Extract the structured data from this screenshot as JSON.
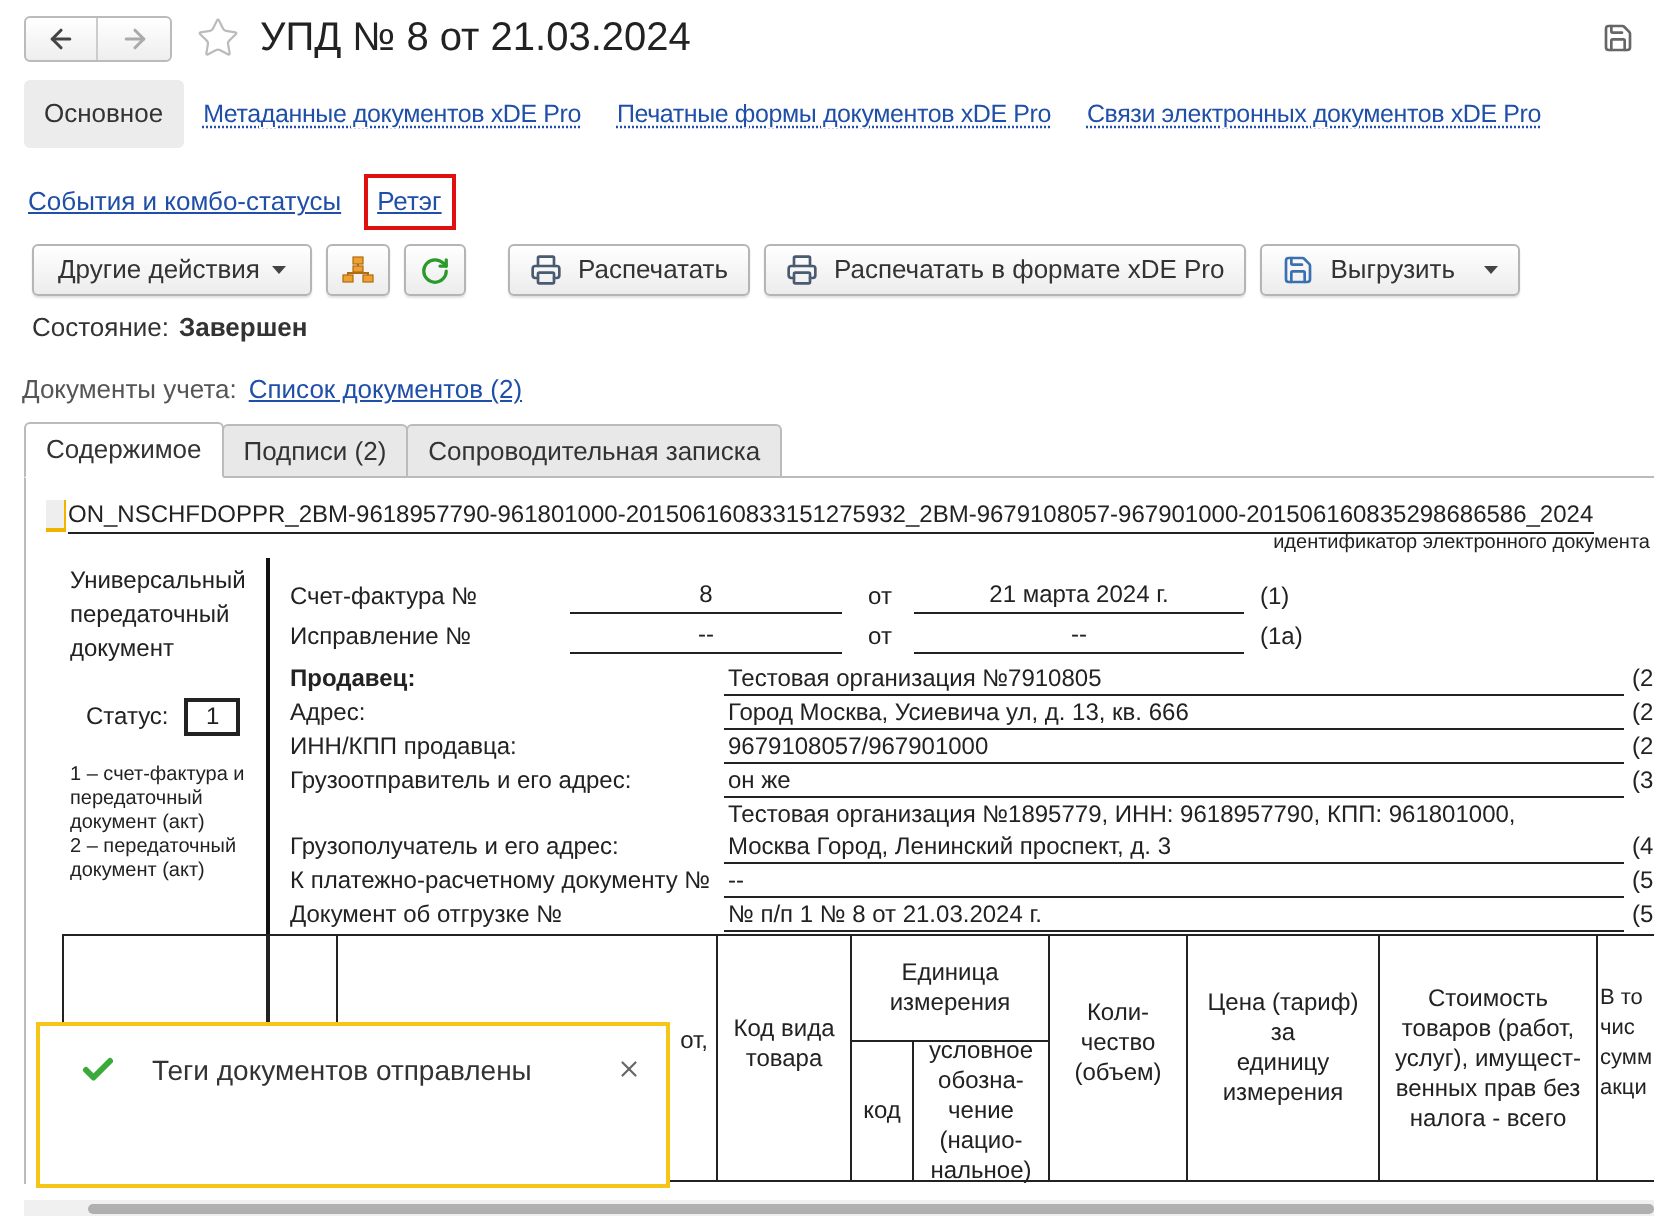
{
  "window": {
    "title": "УПД № 8 от 21.03.2024"
  },
  "tabs": [
    {
      "label": "Основное",
      "selected": true
    },
    {
      "label": "Метаданные документов xDE Pro",
      "selected": false
    },
    {
      "label": "Печатные формы документов xDE Pro",
      "selected": false
    },
    {
      "label": "Связи электронных документов xDE Pro",
      "selected": false
    }
  ],
  "links": [
    {
      "label": "События и комбо-статусы",
      "highlighted": false
    },
    {
      "label": "Ретэг",
      "highlighted": true
    }
  ],
  "toolbar": [
    {
      "kind": "menu",
      "label": "Другие действия"
    },
    {
      "kind": "structure"
    },
    {
      "kind": "refresh"
    },
    {
      "kind": "print",
      "label": "Распечатать"
    },
    {
      "kind": "print",
      "label": "Распечатать в формате xDE Pro"
    },
    {
      "kind": "export",
      "label": "Выгрузить"
    }
  ],
  "state": {
    "label": "Состояние:",
    "value": "Завершен"
  },
  "accounting": {
    "label": "Документы учета:",
    "link": "Список документов (2)"
  },
  "doc_tabs": [
    {
      "label": "Содержимое",
      "selected": true
    },
    {
      "label": "Подписи (2)",
      "selected": false
    },
    {
      "label": "Сопроводительная записка",
      "selected": false
    }
  ],
  "document": {
    "file_id": "ON_NSCHFDOPPR_2BM-9618957790-961801000-201506160833151275932_2BM-9679108057-967901000-201506160835298686586_2024",
    "file_id_caption": "идентификатор электронного документа",
    "doc_type": "Универсальный передаточный документ",
    "status_label": "Статус:",
    "status": "1",
    "status_notes": [
      "1 – счет-фактура и передаточный документ (акт)",
      "2 – передаточный документ (акт)"
    ],
    "invoice_rows": [
      {
        "label": "Счет-фактура №",
        "number": "8",
        "from": "от",
        "date": "21 марта 2024 г.",
        "ref": "(1)"
      },
      {
        "label": "Исправление №",
        "number": "--",
        "from": "от",
        "date": "--",
        "ref": "(1а)"
      }
    ],
    "party_rows": [
      {
        "label": "Продавец:",
        "bold": true,
        "value_lines": [
          "Тестовая организация №7910805"
        ],
        "ref": "(2"
      },
      {
        "label": "Адрес:",
        "bold": false,
        "value_lines": [
          "Город Москва, Усиевича ул, д. 13, кв. 666"
        ],
        "ref": "(2"
      },
      {
        "label": "ИНН/КПП продавца:",
        "bold": false,
        "value_lines": [
          "9679108057/967901000"
        ],
        "ref": "(2"
      },
      {
        "label": "Грузоотправитель и его адрес:",
        "bold": false,
        "value_lines": [
          "он же"
        ],
        "ref": "(3"
      },
      {
        "label": "Грузополучатель и его адрес:",
        "bold": false,
        "value_lines": [
          "Тестовая организация №1895779, ИНН: 9618957790, КПП: 961801000,",
          "Москва Город, Ленинский проспект, д. 3"
        ],
        "ref": "(4"
      },
      {
        "label": "К платежно-расчетному документу №",
        "bold": false,
        "value_lines": [
          "--"
        ],
        "ref": "(5"
      },
      {
        "label": "Документ об отгрузке №",
        "bold": false,
        "value_lines": [
          "№ п/п 1 № 8 от 21.03.2024 г."
        ],
        "ref": "(5"
      }
    ],
    "table": {
      "columns": [
        {
          "lines": [
            "от,"
          ]
        },
        {
          "lines": [
            "Код вида",
            "товара"
          ]
        },
        {
          "lines": [
            "Единица",
            "измерения"
          ],
          "children": [
            {
              "lines": [
                "код"
              ]
            },
            {
              "lines": [
                "условное",
                "обозна-",
                "чение",
                "(нацио-",
                "нальное)"
              ]
            }
          ]
        },
        {
          "lines": [
            "Коли-",
            "чество",
            "(объем)"
          ]
        },
        {
          "lines": [
            "Цена (тариф)",
            "за",
            "единицу",
            "измерения"
          ]
        },
        {
          "lines": [
            "Стоимость",
            "товаров (работ,",
            "услуг), имущест-",
            "венных прав без",
            "налога - всего"
          ]
        },
        {
          "lines": [
            "В то",
            "чис",
            "сумм",
            "акци"
          ]
        }
      ]
    }
  },
  "toast": {
    "kind": "success",
    "message": "Теги документов отправлены"
  }
}
